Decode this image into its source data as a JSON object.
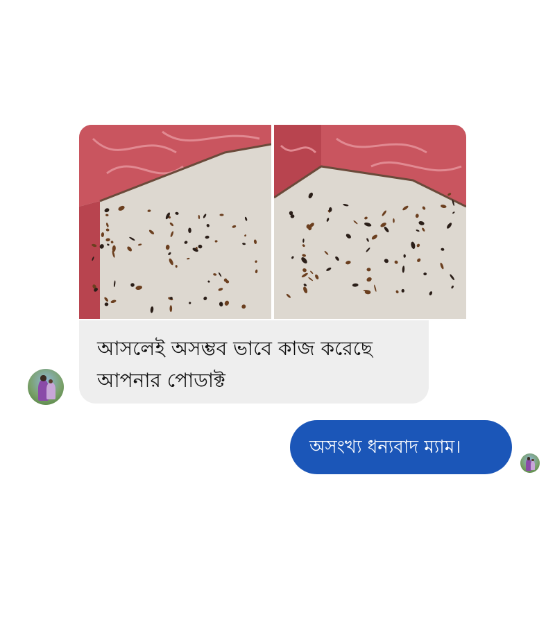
{
  "chat": {
    "images": [
      {
        "icon": "cockroach-photo-1"
      },
      {
        "icon": "cockroach-photo-2"
      }
    ],
    "incoming_message": {
      "lines": [
        "আসলেই অসম্ভব ভাবে কাজ করেছে",
        "আপনার পোডাক্ট"
      ]
    },
    "outgoing_message": {
      "text": "অসংখ্য ধন্যবাদ ম্যাম।"
    },
    "colors": {
      "incoming_bubble": "#eeeeee",
      "outgoing_bubble": "#1b56b8",
      "photo_wall": "#c9555f",
      "photo_floor": "#ddd8d0"
    }
  }
}
